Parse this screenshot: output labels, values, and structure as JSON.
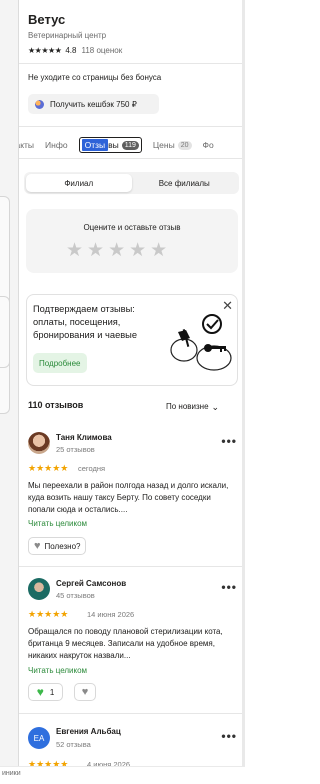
{
  "place": {
    "name": "Ветус",
    "category": "Ветеринарный центр",
    "stars": "★★★★★",
    "rating": "4.8",
    "reviews_count": "118 оценок"
  },
  "bonus": {
    "text": "Не уходите со страницы без бонуса",
    "button": "Получить кешбэк 750 ₽"
  },
  "tabs": [
    {
      "label": "нтакты"
    },
    {
      "label": "Инфо"
    },
    {
      "label_hl": "Отзы",
      "label_rest": "вы",
      "count": "119"
    },
    {
      "label": "Цены",
      "count": "20"
    },
    {
      "label": "Фо"
    }
  ],
  "segment": {
    "branch": "Филиал",
    "all": "Все филиалы"
  },
  "rate_card": {
    "title": "Оцените и оставьте отзыв",
    "stars": "★★★★★"
  },
  "promo": {
    "text": "Подтверждаем отзывы: оплаты, посещения, бронирования и чаевые",
    "button": "Подробнее",
    "close": "✕"
  },
  "reviews_header": {
    "count": "110 отзывов",
    "sort": "По новизне",
    "sort_chevron": "⌄"
  },
  "reviews": [
    {
      "name": "Таня Климова",
      "sub": "25 отзывов",
      "stars": "★★★★★",
      "date": "сегодня",
      "text": "Мы переехали в район полгода назад и долго искали, куда возить нашу таксу Берту. По совету соседки попали сюда и остались....",
      "more": "Читать целиком",
      "helpful": "Полезно?",
      "dots": "•••"
    },
    {
      "name": "Сергей Самсонов",
      "sub": "45 отзывов",
      "stars": "★★★★★",
      "date": "14 июня 2026",
      "text": "Обращался по поводу плановой стерилизации кота, британца 9 месяцев. Записали на удобное время, никаких накруток назвали...",
      "more": "Читать целиком",
      "likes": "1",
      "dots": "•••"
    },
    {
      "name": "Евгения Альбац",
      "initials": "ЕА",
      "sub": "52 отзыва",
      "stars": "★★★★★",
      "date": "4 июня 2026",
      "dots": "•••"
    }
  ],
  "bottom_tip": "иники",
  "colors": {
    "accent_green": "#2b8a3a",
    "star_orange": "#f2a300",
    "active_tab_highlight": "#2e63d8",
    "avatar_blue": "#2f6fde"
  }
}
